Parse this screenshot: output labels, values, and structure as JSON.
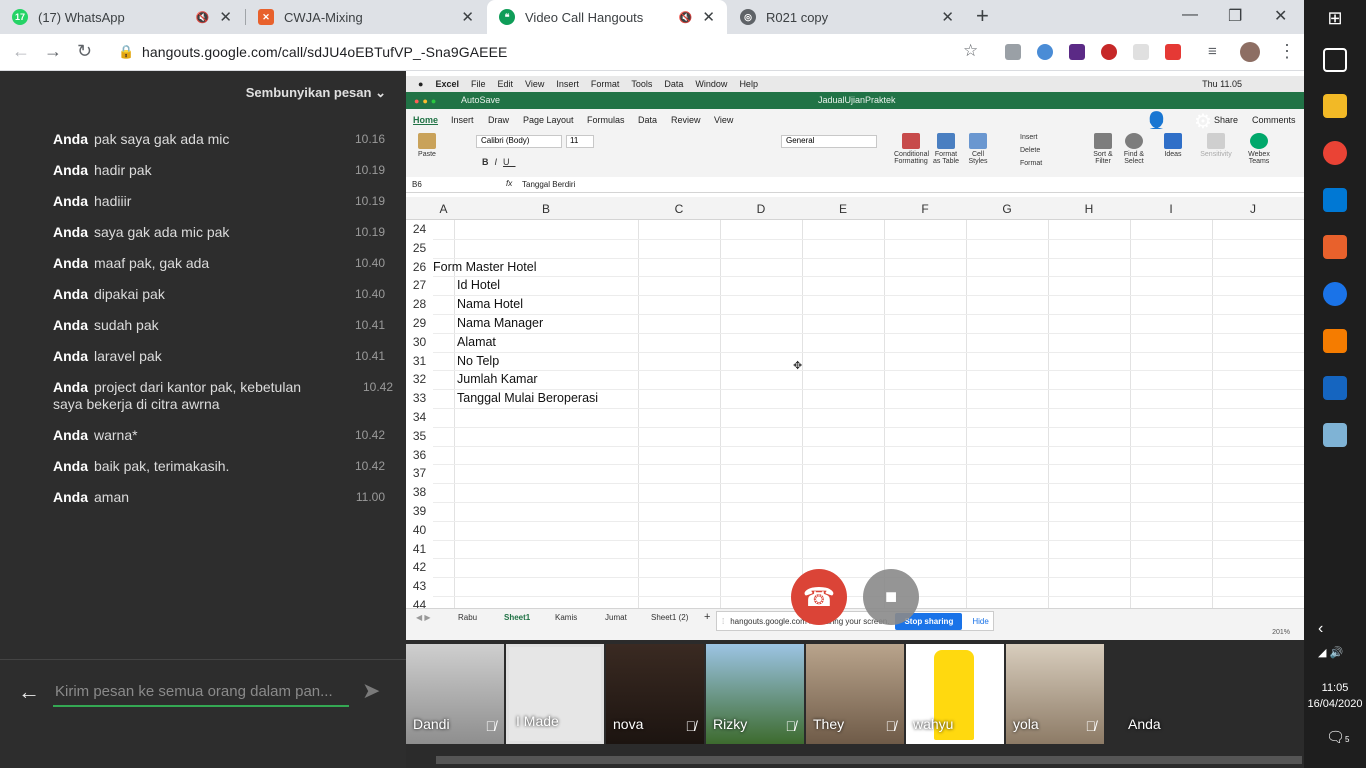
{
  "tabs": [
    {
      "title": "(17) WhatsApp",
      "badge": "17",
      "color": "#25d366",
      "icon": "whatsapp-icon"
    },
    {
      "title": "CWJA-Mixing",
      "color": "#e8612c",
      "icon": "xampp-icon"
    },
    {
      "title": "Video Call Hangouts",
      "color": "#0f9d58",
      "icon": "hangouts-icon"
    },
    {
      "title": "R021 copy",
      "color": "#5f6368",
      "icon": "globe-icon"
    }
  ],
  "address_bar": {
    "url": "hangouts.google.com/call/sdJU4oEBTufVP_-Sna9GAEEE"
  },
  "chat": {
    "hide_label": "Sembunyikan pesan",
    "messages": [
      {
        "sender": "Anda",
        "text": "pak saya gak ada mic",
        "time": "10.16"
      },
      {
        "sender": "Anda",
        "text": "hadir pak",
        "time": "10.19"
      },
      {
        "sender": "Anda",
        "text": "hadiiir",
        "time": "10.19"
      },
      {
        "sender": "Anda",
        "text": "saya gak ada mic pak",
        "time": "10.19"
      },
      {
        "sender": "Anda",
        "text": "maaf pak, gak ada",
        "time": "10.40"
      },
      {
        "sender": "Anda",
        "text": "dipakai pak",
        "time": "10.40"
      },
      {
        "sender": "Anda",
        "text": "sudah pak",
        "time": "10.41"
      },
      {
        "sender": "Anda",
        "text": "laravel pak",
        "time": "10.41"
      },
      {
        "sender": "Anda",
        "text": "project dari kantor pak, kebetulan saya bekerja di citra awrna",
        "time": "10.42"
      },
      {
        "sender": "Anda",
        "text": "warna*",
        "time": "10.42"
      },
      {
        "sender": "Anda",
        "text": "baik pak, terimakasih.",
        "time": "10.42"
      },
      {
        "sender": "Anda",
        "text": "aman",
        "time": "11.00"
      }
    ],
    "input_placeholder": "Kirim pesan ke semua orang dalam pan..."
  },
  "excel": {
    "menu": [
      "Excel",
      "File",
      "Edit",
      "View",
      "Insert",
      "Format",
      "Tools",
      "Data",
      "Window",
      "Help"
    ],
    "status_right": "Thu 11.05",
    "doc_title": "JadualUjianPraktek",
    "autosave": "AutoSave",
    "ribbon_tabs": [
      "Home",
      "Insert",
      "Draw",
      "Page Layout",
      "Formulas",
      "Data",
      "Review",
      "View"
    ],
    "share": "Share",
    "comments": "Comments",
    "font_name": "Calibri (Body)",
    "font_size": "11",
    "number_format": "General",
    "paste": "Paste",
    "groups": [
      "Conditional Formatting",
      "Format as Table",
      "Cell Styles",
      "Insert",
      "Delete",
      "Format",
      "Sort & Filter",
      "Find & Select",
      "Ideas",
      "Sensitivity",
      "Webex Teams"
    ],
    "name_box": "B6",
    "formula": "Tanggal Berdiri",
    "columns": [
      "A",
      "B",
      "C",
      "D",
      "E",
      "F",
      "G",
      "H",
      "I",
      "J"
    ],
    "rows": [
      "24",
      "25",
      "26",
      "27",
      "28",
      "29",
      "30",
      "31",
      "32",
      "33",
      "34",
      "35",
      "36",
      "37",
      "38",
      "39",
      "40",
      "41",
      "42",
      "43",
      "44"
    ],
    "cells": [
      {
        "row": "26",
        "text": "Form Master Hotel",
        "indent": false
      },
      {
        "row": "27",
        "text": "Id Hotel",
        "indent": true
      },
      {
        "row": "28",
        "text": "Nama Hotel",
        "indent": true
      },
      {
        "row": "29",
        "text": "Nama Manager",
        "indent": true
      },
      {
        "row": "30",
        "text": "Alamat",
        "indent": true
      },
      {
        "row": "31",
        "text": "No Telp",
        "indent": true
      },
      {
        "row": "32",
        "text": "Jumlah Kamar",
        "indent": true
      },
      {
        "row": "33",
        "text": "Tanggal Mulai Beroperasi",
        "indent": true
      }
    ],
    "sheets": [
      "Rabu",
      "Sheet1",
      "Kamis",
      "Jumat",
      "Sheet1 (2)"
    ],
    "active_sheet": "Sheet1",
    "zoom": "201%"
  },
  "share_bar": {
    "text": "hangouts.google.com is sharing your screen.",
    "stop": "Stop sharing",
    "hide": "Hide"
  },
  "participants": [
    {
      "name": "Dandi",
      "muted": true
    },
    {
      "name": "I Made",
      "muted": false
    },
    {
      "name": "nova",
      "muted": true
    },
    {
      "name": "Rizky",
      "muted": true
    },
    {
      "name": "They",
      "muted": true
    },
    {
      "name": "wahyu",
      "muted": true
    },
    {
      "name": "yola",
      "muted": true
    },
    {
      "name": "Anda",
      "muted": true
    }
  ],
  "taskbar": {
    "time": "11:05",
    "date": "16/04/2020",
    "notifications": "5"
  }
}
